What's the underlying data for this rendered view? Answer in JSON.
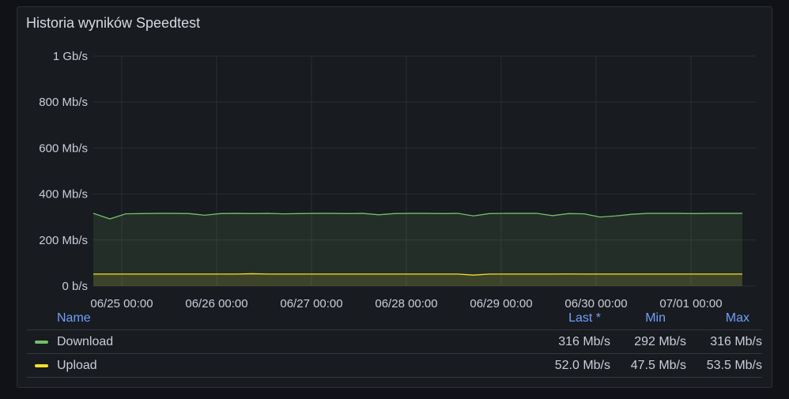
{
  "panel": {
    "title": "Historia wyników Speedtest"
  },
  "legend": {
    "headers": {
      "name": "Name",
      "last": "Last *",
      "min": "Min",
      "max": "Max"
    },
    "rows": [
      {
        "name": "Download",
        "color": "#73bf69",
        "last": "316 Mb/s",
        "min": "292 Mb/s",
        "max": "316 Mb/s"
      },
      {
        "name": "Upload",
        "color": "#fade2a",
        "last": "52.0 Mb/s",
        "min": "47.5 Mb/s",
        "max": "53.5 Mb/s"
      }
    ]
  },
  "chart_data": {
    "type": "area",
    "title": "Historia wyników Speedtest",
    "x_unit": "hours since 06/25 00:00",
    "xlim": [
      -7.2,
      160.4
    ],
    "ylim": [
      0,
      1000
    ],
    "y_ticks": [
      0,
      200,
      400,
      600,
      800,
      1000
    ],
    "y_tick_labels": [
      "0 b/s",
      "200 Mb/s",
      "400 Mb/s",
      "600 Mb/s",
      "800 Mb/s",
      "1 Gb/s"
    ],
    "x_ticks": [
      0,
      24,
      48,
      72,
      96,
      120,
      144
    ],
    "x_tick_labels": [
      "06/25 00:00",
      "06/26 00:00",
      "06/27 00:00",
      "06/28 00:00",
      "06/29 00:00",
      "06/30 00:00",
      "07/01 00:00"
    ],
    "grid": true,
    "legend_position": "bottom",
    "x": [
      -7,
      -3,
      1,
      5,
      9,
      13,
      17,
      21,
      25,
      29,
      33,
      37,
      41,
      45,
      49,
      53,
      57,
      61,
      65,
      69,
      73,
      77,
      81,
      85,
      89,
      93,
      97,
      101,
      105,
      109,
      113,
      117,
      121,
      125,
      129,
      133,
      137,
      141,
      145,
      149,
      153,
      157
    ],
    "series": [
      {
        "name": "Download",
        "color": "#73bf69",
        "values": [
          316,
          292,
          314,
          315,
          316,
          316,
          315,
          308,
          315,
          316,
          315,
          316,
          314,
          315,
          316,
          316,
          315,
          316,
          310,
          315,
          316,
          316,
          315,
          316,
          305,
          315,
          316,
          316,
          316,
          306,
          315,
          314,
          300,
          305,
          312,
          316,
          316,
          316,
          315,
          316,
          316,
          316
        ]
      },
      {
        "name": "Upload",
        "color": "#fade2a",
        "values": [
          52,
          52,
          52,
          52,
          52,
          52,
          52,
          52,
          52,
          52,
          53.5,
          52,
          52,
          52,
          52,
          52,
          52,
          52,
          52,
          52,
          52,
          52,
          52,
          52,
          47.5,
          52,
          52,
          52,
          52,
          52,
          52.5,
          52,
          52,
          52,
          52,
          52,
          52,
          52,
          52,
          52,
          52,
          52
        ]
      }
    ]
  }
}
